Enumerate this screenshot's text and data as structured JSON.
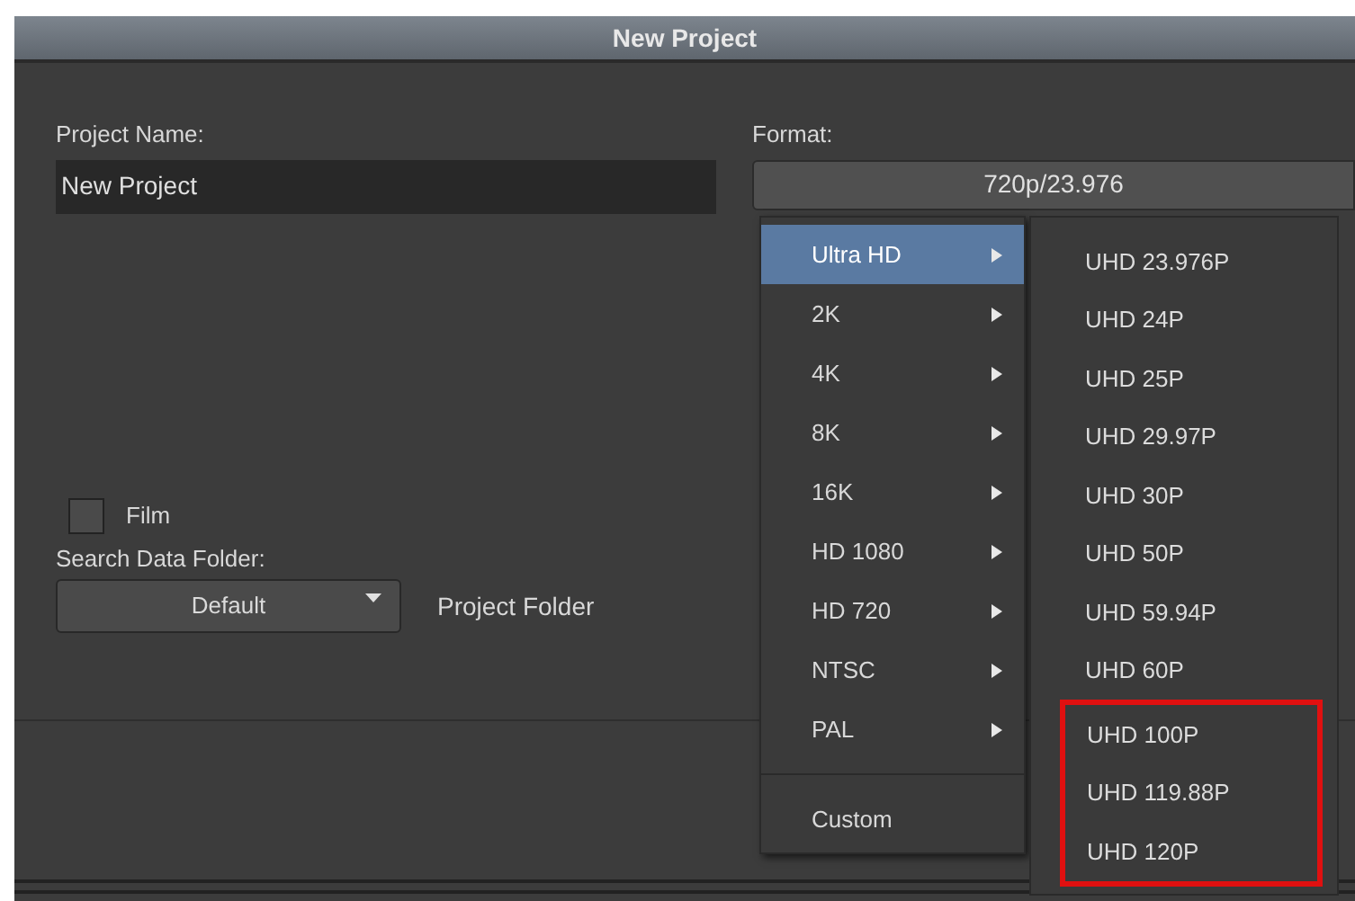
{
  "window": {
    "title": "New Project"
  },
  "project_name": {
    "label": "Project Name:",
    "value": "New Project"
  },
  "format": {
    "label": "Format:",
    "value": "720p/23.976"
  },
  "film": {
    "label": "Film",
    "checked": false
  },
  "search_data_folder": {
    "label": "Search Data Folder:",
    "value": "Default",
    "folder": "Project Folder"
  },
  "format_menu": {
    "items": [
      {
        "label": "Ultra HD",
        "submenu": true,
        "selected": true
      },
      {
        "label": "2K",
        "submenu": true,
        "selected": false
      },
      {
        "label": "4K",
        "submenu": true,
        "selected": false
      },
      {
        "label": "8K",
        "submenu": true,
        "selected": false
      },
      {
        "label": "16K",
        "submenu": true,
        "selected": false
      },
      {
        "label": "HD 1080",
        "submenu": true,
        "selected": false
      },
      {
        "label": "HD 720",
        "submenu": true,
        "selected": false
      },
      {
        "label": "NTSC",
        "submenu": true,
        "selected": false
      },
      {
        "label": "PAL",
        "submenu": true,
        "selected": false
      },
      {
        "label": "Custom",
        "submenu": false,
        "selected": false
      }
    ]
  },
  "submenu": {
    "items": [
      {
        "label": "UHD 23.976P",
        "marked": false
      },
      {
        "label": "UHD 24P",
        "marked": false
      },
      {
        "label": "UHD 25P",
        "marked": false
      },
      {
        "label": "UHD 29.97P",
        "marked": false
      },
      {
        "label": "UHD 30P",
        "marked": false
      },
      {
        "label": "UHD 50P",
        "marked": false
      },
      {
        "label": "UHD 59.94P",
        "marked": false
      },
      {
        "label": "UHD 60P",
        "marked": false
      },
      {
        "label": "UHD 100P",
        "marked": true
      },
      {
        "label": "UHD 119.88P",
        "marked": true
      },
      {
        "label": "UHD 120P",
        "marked": true
      }
    ]
  }
}
